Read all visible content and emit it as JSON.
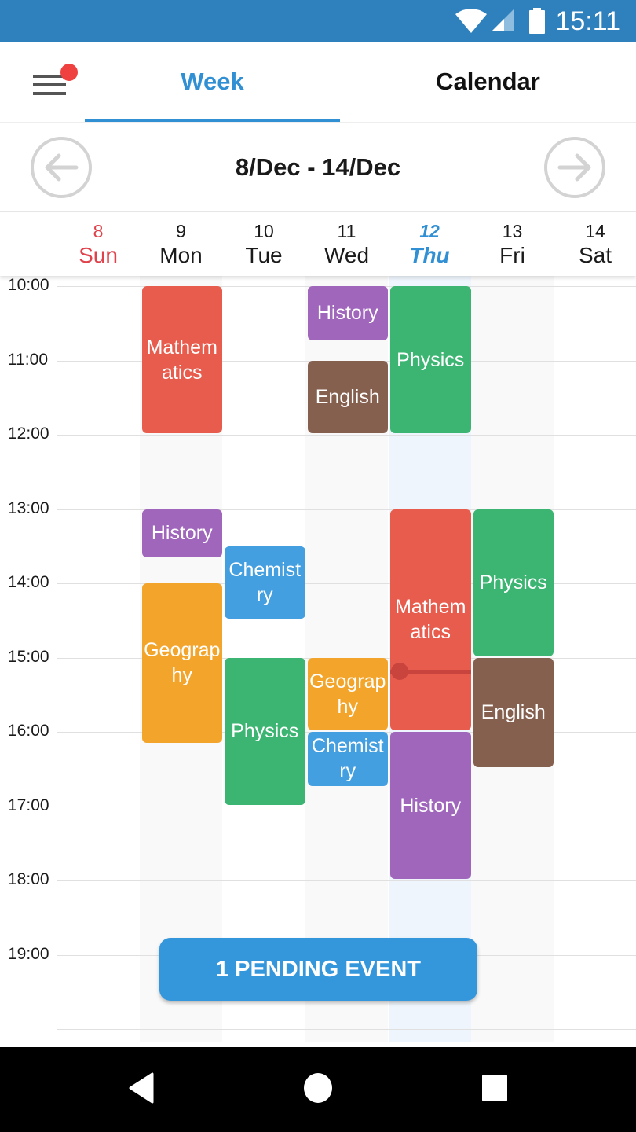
{
  "status_bar": {
    "time": "15:11",
    "icons": [
      "wifi-icon",
      "cell-signal-icon",
      "battery-icon"
    ]
  },
  "app_bar": {
    "menu_icon": "hamburger-menu-icon",
    "has_notification_dot": true,
    "tabs": [
      {
        "label": "Week",
        "active": true
      },
      {
        "label": "Calendar",
        "active": false
      }
    ]
  },
  "week_nav": {
    "range": "8/Dec - 14/Dec",
    "prev_icon": "arrow-left-circle-icon",
    "next_icon": "arrow-right-circle-icon"
  },
  "days": [
    {
      "num": "8",
      "name": "Sun",
      "kind": "sunday"
    },
    {
      "num": "9",
      "name": "Mon",
      "kind": ""
    },
    {
      "num": "10",
      "name": "Tue",
      "kind": ""
    },
    {
      "num": "11",
      "name": "Wed",
      "kind": ""
    },
    {
      "num": "12",
      "name": "Thu",
      "kind": "today"
    },
    {
      "num": "13",
      "name": "Fri",
      "kind": ""
    },
    {
      "num": "14",
      "name": "Sat",
      "kind": ""
    }
  ],
  "hours": [
    "10:00",
    "11:00",
    "12:00",
    "13:00",
    "14:00",
    "15:00",
    "16:00",
    "17:00",
    "18:00",
    "19:00"
  ],
  "colors": {
    "Mathematics": "#e85c4e",
    "History": "#a066bc",
    "Geography": "#f3a52b",
    "Chemistry": "#439fe0",
    "Physics": "#3cb572",
    "English": "#86604f",
    "accent": "#3190d4",
    "now_line": "#c8443d"
  },
  "events": [
    {
      "day": 1,
      "title": "Mathematics",
      "start": "10:00",
      "end": "12:00"
    },
    {
      "day": 1,
      "title": "History",
      "start": "13:00",
      "end": "13:40"
    },
    {
      "day": 1,
      "title": "Geography",
      "start": "14:00",
      "end": "16:10"
    },
    {
      "day": 2,
      "title": "Chemistry",
      "start": "13:30",
      "end": "14:30"
    },
    {
      "day": 2,
      "title": "Physics",
      "start": "15:00",
      "end": "17:00"
    },
    {
      "day": 3,
      "title": "History",
      "start": "10:00",
      "end": "10:45"
    },
    {
      "day": 3,
      "title": "English",
      "start": "11:00",
      "end": "12:00"
    },
    {
      "day": 3,
      "title": "Geography",
      "start": "15:00",
      "end": "16:00"
    },
    {
      "day": 3,
      "title": "Chemistry",
      "start": "16:00",
      "end": "16:45"
    },
    {
      "day": 4,
      "title": "Physics",
      "start": "10:00",
      "end": "12:00"
    },
    {
      "day": 4,
      "title": "Mathematics",
      "start": "13:00",
      "end": "16:00"
    },
    {
      "day": 4,
      "title": "History",
      "start": "16:00",
      "end": "18:00"
    },
    {
      "day": 5,
      "title": "Physics",
      "start": "13:00",
      "end": "15:00"
    },
    {
      "day": 5,
      "title": "English",
      "start": "15:00",
      "end": "16:30"
    }
  ],
  "current_time": {
    "day": 4,
    "time": "15:11"
  },
  "pending_button": {
    "label": "1 PENDING EVENT"
  },
  "nav_bar": {
    "icons": [
      "back-icon",
      "home-icon",
      "recents-icon"
    ]
  }
}
